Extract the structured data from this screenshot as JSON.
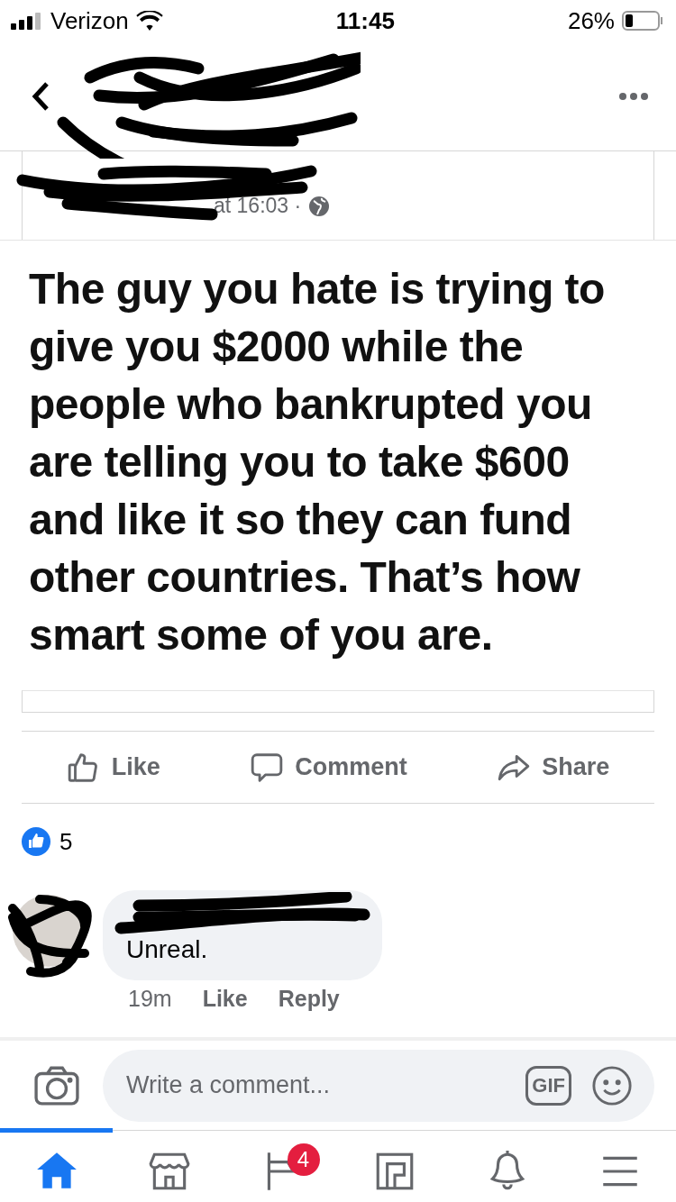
{
  "status_bar": {
    "carrier": "Verizon",
    "time": "11:45",
    "battery": "26%"
  },
  "post": {
    "timestamp": "at 16:03 ·",
    "text": "The guy you hate is trying to give you $2000 while the people who bankrupted you are telling you to take $600 and like it so they can fund other countries. That’s how smart some of you are."
  },
  "actions": [
    {
      "kind": "like",
      "label": "Like"
    },
    {
      "kind": "comment",
      "label": "Comment"
    },
    {
      "kind": "share",
      "label": "Share"
    }
  ],
  "reactions": {
    "count": "5"
  },
  "comments": [
    {
      "text": "Unreal.",
      "time": "19m",
      "like": "Like",
      "reply": "Reply"
    }
  ],
  "composer": {
    "placeholder": "Write a comment...",
    "gif": "GIF"
  },
  "tabs": [
    {
      "kind": "home",
      "selected": true
    },
    {
      "kind": "marketplace",
      "selected": false
    },
    {
      "kind": "pages",
      "selected": false,
      "badge": "4"
    },
    {
      "kind": "gaming",
      "selected": false
    },
    {
      "kind": "notifications",
      "selected": false
    },
    {
      "kind": "menu",
      "selected": false
    }
  ]
}
